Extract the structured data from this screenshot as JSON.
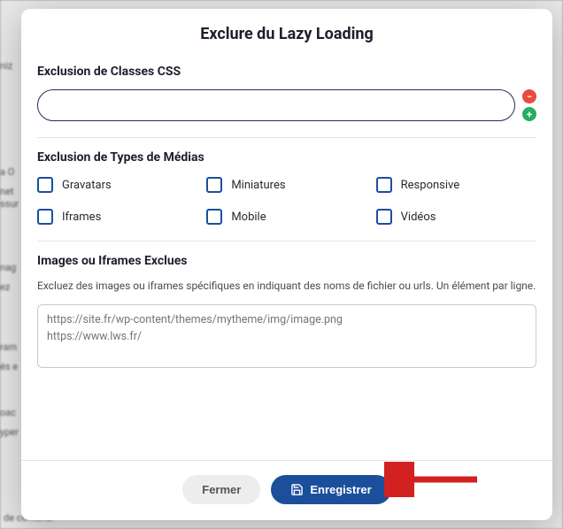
{
  "modal": {
    "title": "Exclure du Lazy Loading",
    "css_section": {
      "title": "Exclusion de Classes CSS",
      "input_value": ""
    },
    "media_section": {
      "title": "Exclusion de Types de Médias",
      "options": [
        {
          "key": "gravatars",
          "label": "Gravatars"
        },
        {
          "key": "miniatures",
          "label": "Miniatures"
        },
        {
          "key": "responsive",
          "label": "Responsive"
        },
        {
          "key": "iframes",
          "label": "Iframes"
        },
        {
          "key": "mobile",
          "label": "Mobile"
        },
        {
          "key": "videos",
          "label": "Vidéos"
        }
      ]
    },
    "exclude_section": {
      "title": "Images ou Iframes Exclues",
      "description": "Excluez des images ou iframes spécifiques en indiquant des noms de fichier ou urls. Un élément par ligne.",
      "placeholder": "https://site.fr/wp-content/themes/mytheme/img/image.png\nhttps://www.lws.fr/",
      "value": ""
    },
    "footer": {
      "close_label": "Fermer",
      "save_label": "Enregistrer"
    }
  },
  "bg_fragments": {
    "f1": "niz",
    "f2": "a O",
    "f3": "net",
    "f4": "ssur",
    "f5": "nag",
    "f6": "ez",
    "f7": "ram",
    "f8": "és e",
    "f9": "oac",
    "f10": "yper",
    "f11": "de contenu."
  },
  "icons": {
    "remove": "remove-icon",
    "add": "add-icon",
    "save": "save-icon"
  },
  "colors": {
    "primary": "#1b4f9c",
    "danger": "#e74c3c",
    "success": "#27ae60",
    "arrow": "#d32020"
  }
}
